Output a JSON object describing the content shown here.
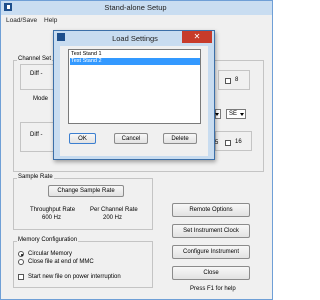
{
  "window": {
    "title": "Stand-alone Setup"
  },
  "menu": {
    "items": [
      "Load/Save",
      "Help"
    ]
  },
  "channel_setup": {
    "label": "Channel Set",
    "row_labels": [
      "Diff -",
      "Mode",
      "Diff -"
    ],
    "right_checkboxes": [
      "8",
      "16"
    ],
    "right_checkbox_prefix": "5",
    "dropdown_value": "SE"
  },
  "sample_rate": {
    "label": "Sample Rate",
    "change_button": "Change Sample Rate",
    "throughput_label": "Throughput Rate",
    "throughput_value": "600 Hz",
    "per_channel_label": "Per Channel Rate",
    "per_channel_value": "200 Hz"
  },
  "memory": {
    "label": "Memory Configuration",
    "options": [
      "Circular Memory",
      "Close file at end of MMC"
    ],
    "selected_index": 0,
    "power_checkbox": "Start new file on power interruption"
  },
  "buttons": {
    "remote_options": "Remote Options",
    "set_clock": "Set Instrument Clock",
    "configure": "Configure Instrument",
    "close": "Close"
  },
  "help_hint": "Press F1 for help",
  "dialog": {
    "title": "Load Settings",
    "close_glyph": "✕",
    "items": [
      "Test Stand 1",
      "Test Stand 2"
    ],
    "selected_index": 1,
    "ok": "OK",
    "cancel": "Cancel",
    "delete": "Delete"
  }
}
